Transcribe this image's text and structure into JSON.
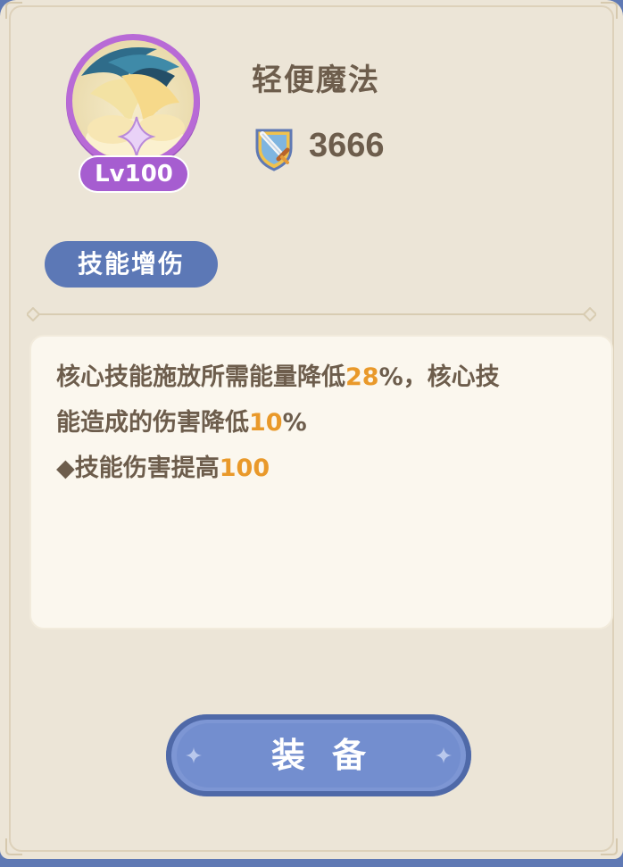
{
  "skill": {
    "name": "轻便魔法",
    "level_badge": "Lv100",
    "power_value": "3666",
    "tag_label": "技能增伤"
  },
  "description": {
    "line1_prefix": "核心技能施放所需能量降低",
    "line1_value": "28",
    "line1_suffix": "%，核心技",
    "line2_prefix": "能造成的伤害降低",
    "line2_value": "10",
    "line2_suffix": "%",
    "line3_prefix": "◆技能伤害提高",
    "line3_value": "100"
  },
  "actions": {
    "equip_label": "装备"
  },
  "icons": {
    "avatar": "skill-art-icon",
    "power": "sword-shield-icon"
  },
  "colors": {
    "highlight": "#e9992a",
    "text": "#6d5d4c",
    "accent_blue": "#5c78b6",
    "level_purple": "#a65dd0"
  }
}
